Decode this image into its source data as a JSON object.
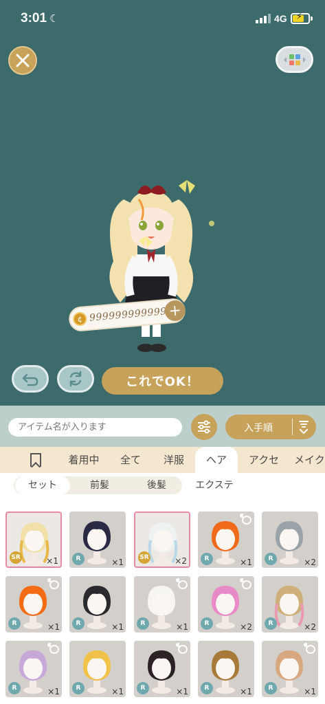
{
  "status": {
    "time": "3:01",
    "network": "4G"
  },
  "stage": {
    "coin_amount": "9999999999999",
    "ok_label": "これでOK！"
  },
  "search": {
    "placeholder": "アイテム名が入ります",
    "sort_label": "入手順"
  },
  "categories": [
    "着用中",
    "全て",
    "洋服",
    "ヘア",
    "アクセ",
    "メイク"
  ],
  "active_category": "ヘア",
  "subcategories": [
    "セット",
    "前髪",
    "後髪",
    "エクステ"
  ],
  "active_subcategory": "セット",
  "items": [
    {
      "rarity": "SR",
      "count": "×1",
      "hair": "#f1e0a8",
      "accent": "#e8b84a",
      "selected": true,
      "bear": false
    },
    {
      "rarity": "R",
      "count": "×1",
      "hair": "#2a2a45",
      "selected": false,
      "bear": false
    },
    {
      "rarity": "SR",
      "count": "×2",
      "hair": "#eef2f0",
      "accent": "#b8d8e8",
      "selected": true,
      "bear": false
    },
    {
      "rarity": "R",
      "count": "×1",
      "hair": "#f06a1a",
      "selected": false,
      "bear": true
    },
    {
      "rarity": "R",
      "count": "×2",
      "hair": "#9aa3a8",
      "selected": false,
      "bear": false
    },
    {
      "rarity": "R",
      "count": "×1",
      "hair": "#f36c14",
      "selected": false,
      "bear": true
    },
    {
      "rarity": "R",
      "count": "×1",
      "hair": "#2b2a2e",
      "selected": false,
      "bear": false
    },
    {
      "rarity": "R",
      "count": "×1",
      "hair": "#f7f5f0",
      "selected": false,
      "bear": true
    },
    {
      "rarity": "R",
      "count": "×2",
      "hair": "#e88ac8",
      "selected": false,
      "bear": true
    },
    {
      "rarity": "R",
      "count": "×2",
      "hair": "#cfb07a",
      "accent": "#e89ab0",
      "selected": false,
      "bear": false
    },
    {
      "rarity": "R",
      "count": "×1",
      "hair": "#c7a8d8",
      "selected": false,
      "bear": true
    },
    {
      "rarity": "R",
      "count": "×1",
      "hair": "#f1c24a",
      "selected": false,
      "bear": false
    },
    {
      "rarity": "R",
      "count": "×1",
      "hair": "#2c2326",
      "selected": false,
      "bear": true
    },
    {
      "rarity": "R",
      "count": "×1",
      "hair": "#a77a3a",
      "selected": false,
      "bear": false
    },
    {
      "rarity": "R",
      "count": "×1",
      "hair": "#d8a880",
      "selected": false,
      "bear": true
    }
  ]
}
